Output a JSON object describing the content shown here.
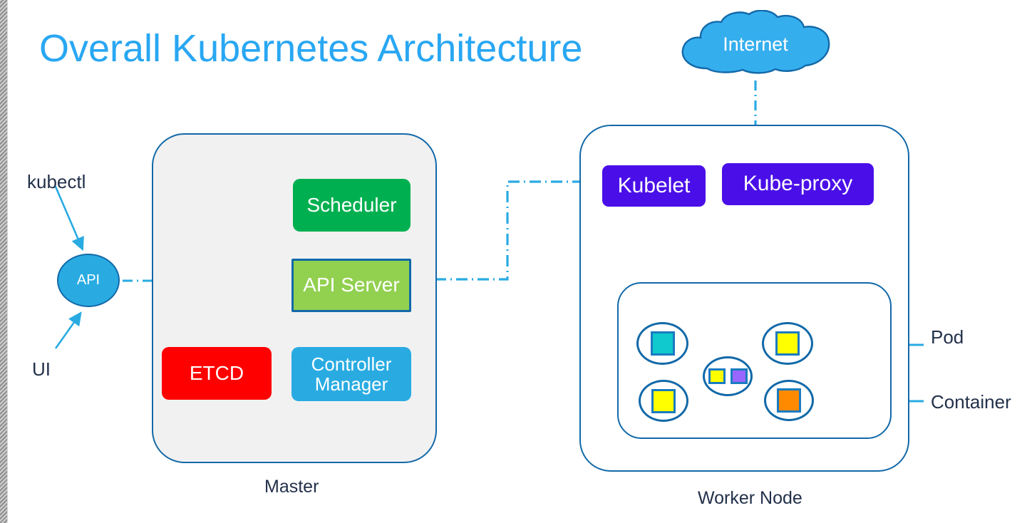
{
  "title": "Overall Kubernetes Architecture",
  "colors": {
    "title_blue": "#29A7F2",
    "outline_blue": "#1269A8",
    "connector_blue": "#29ABE2",
    "label_navy": "#22304A",
    "scheduler_green": "#00B050",
    "apiserver_green": "#92D050",
    "etcd_red": "#FF0000",
    "controller_blue": "#29ABE2",
    "kubelet_purple": "#4A0FE8",
    "container_teal": "#0FC9CE",
    "container_yellow": "#FFFF00",
    "container_orange": "#FF8A00",
    "container_violet": "#9966FF",
    "master_fill": "#F1F1F1"
  },
  "clients": {
    "kubectl_label": "kubectl",
    "ui_label": "UI",
    "api_circle_label": "API"
  },
  "master": {
    "label": "Master",
    "components": [
      {
        "id": "scheduler",
        "label": "Scheduler"
      },
      {
        "id": "api-server",
        "label": "API Server"
      },
      {
        "id": "etcd",
        "label": "ETCD"
      },
      {
        "id": "controller-manager",
        "label": "Controller Manager"
      }
    ]
  },
  "worker": {
    "label": "Worker Node",
    "components": [
      {
        "id": "kubelet",
        "label": "Kubelet"
      },
      {
        "id": "kube-proxy",
        "label": "Kube-proxy"
      }
    ],
    "pods": [
      {
        "id": "pod-1",
        "containers": [
          {
            "color": "#0FC9CE"
          }
        ]
      },
      {
        "id": "pod-2",
        "containers": [
          {
            "color": "#FFFF00"
          }
        ]
      },
      {
        "id": "pod-3",
        "containers": [
          {
            "color": "#FFFF00"
          },
          {
            "color": "#9966FF"
          }
        ]
      },
      {
        "id": "pod-4",
        "containers": [
          {
            "color": "#FFFF00"
          }
        ]
      },
      {
        "id": "pod-5",
        "containers": [
          {
            "color": "#FF8A00"
          }
        ]
      }
    ]
  },
  "internet": {
    "label": "Internet"
  },
  "legend": {
    "pod_label": "Pod",
    "container_label": "Container"
  }
}
